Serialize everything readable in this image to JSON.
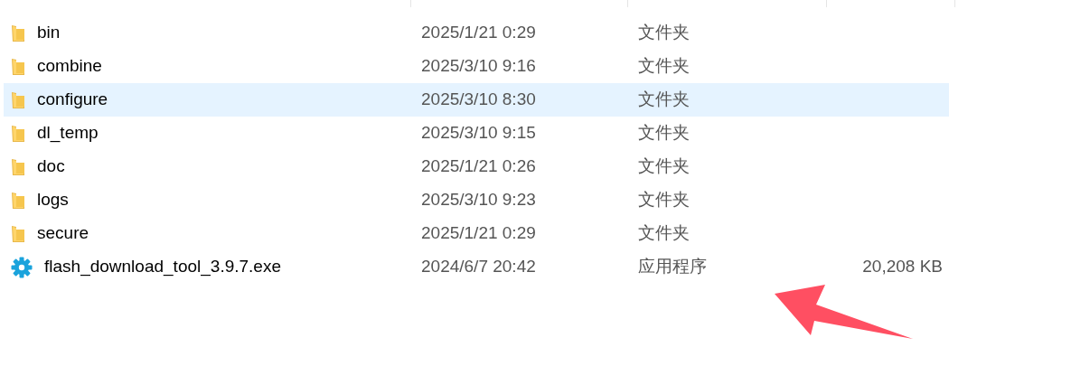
{
  "files": [
    {
      "kind": "folder",
      "name": "bin",
      "modified": "2025/1/21 0:29",
      "type": "文件夹",
      "selected": false
    },
    {
      "kind": "folder",
      "name": "combine",
      "modified": "2025/3/10 9:16",
      "type": "文件夹",
      "selected": false
    },
    {
      "kind": "folder",
      "name": "configure",
      "modified": "2025/3/10 8:30",
      "type": "文件夹",
      "selected": true
    },
    {
      "kind": "folder",
      "name": "dl_temp",
      "modified": "2025/3/10 9:15",
      "type": "文件夹",
      "selected": false
    },
    {
      "kind": "folder",
      "name": "doc",
      "modified": "2025/1/21 0:26",
      "type": "文件夹",
      "selected": false
    },
    {
      "kind": "folder",
      "name": "logs",
      "modified": "2025/3/10 9:23",
      "type": "文件夹",
      "selected": false
    },
    {
      "kind": "folder",
      "name": "secure",
      "modified": "2025/1/21 0:29",
      "type": "文件夹",
      "selected": false
    },
    {
      "kind": "app",
      "name": "flash_download_tool_3.9.7.exe",
      "modified": "2024/6/7 20:42",
      "type": "应用程序",
      "size": "20,208 KB",
      "selected": false
    }
  ]
}
